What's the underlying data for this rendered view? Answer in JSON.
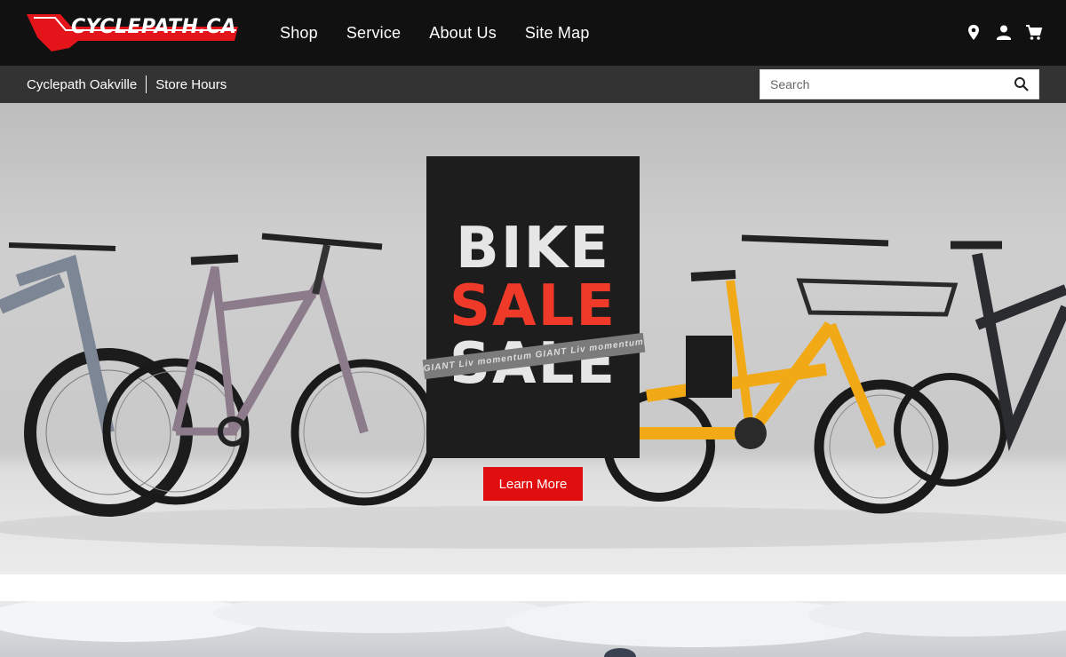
{
  "header": {
    "logo_text": "CYCLEPATH.CA",
    "nav": [
      "Shop",
      "Service",
      "About Us",
      "Site Map"
    ],
    "icons": [
      "location-icon",
      "account-icon",
      "cart-icon"
    ]
  },
  "subbar": {
    "store": "Cyclepath Oakville",
    "hours": "Store Hours"
  },
  "search": {
    "placeholder": "Search"
  },
  "hero": {
    "line1": "BIKE",
    "line2": "SALE",
    "line3": "SALE",
    "tape_text": "GIANT Liv momentum GIANT Liv momentum GIANT Liv",
    "cta": "Learn More"
  },
  "colors": {
    "topbar": "#111111",
    "subbar": "#333333",
    "accent_red": "#e00e0e",
    "sale_red": "#ef3a2a"
  }
}
